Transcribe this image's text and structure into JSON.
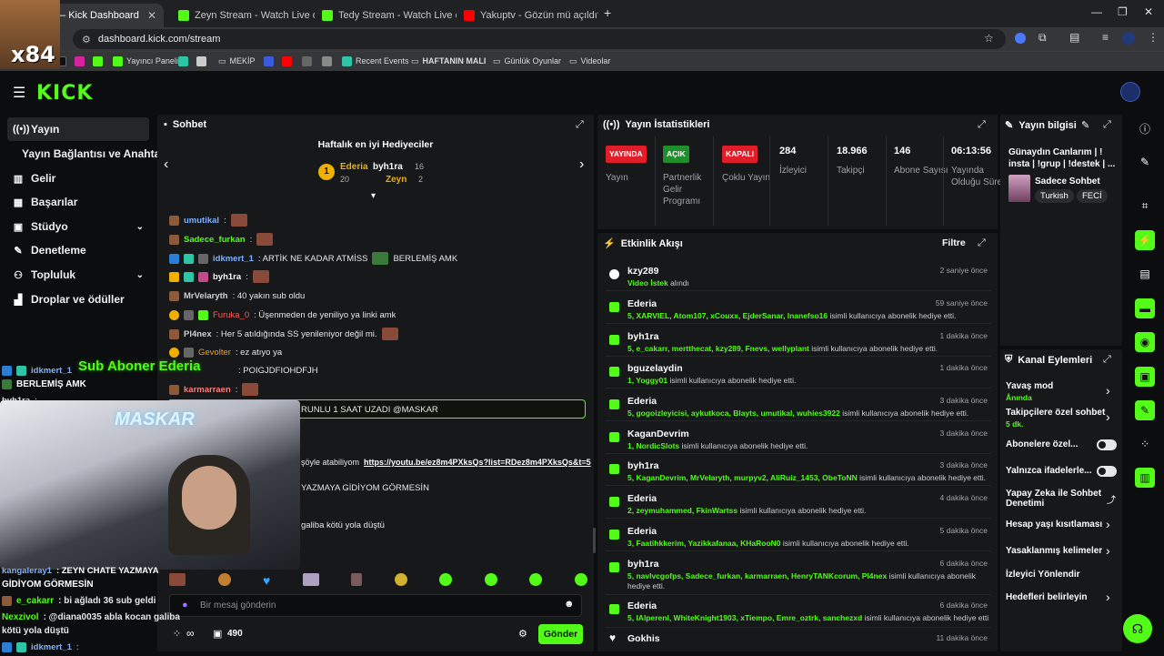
{
  "browser": {
    "tabs": [
      {
        "label": "Kick Dashboard",
        "prefix": "– ",
        "active": true,
        "favicon": "kick"
      },
      {
        "label": "Zeyn Stream - Watch Live on Ki",
        "active": false,
        "favicon": "kick"
      },
      {
        "label": "Tedy Stream - Watch Live on Ki",
        "active": false,
        "favicon": "kick"
      },
      {
        "label": "Yakuptv - Gözün mü açıldı? Gö",
        "active": false,
        "favicon": "youtube"
      }
    ],
    "url": "dashboard.kick.com/stream",
    "bookmarks": [
      "Yayıncı Paneli",
      "MEKİP",
      "Recent Events",
      "HAFTANIN MALI",
      "Günlük Oyunlar",
      "Videolar"
    ]
  },
  "overlay": {
    "streamer_tag": "x84",
    "cam_label": "MASKAR",
    "alert_text": "Sub Aboner Ederia",
    "side_chat": [
      {
        "user": "idkmert_1",
        "text": ""
      },
      {
        "user": "",
        "text": "BERLEMİŞ AMK"
      },
      {
        "user": "byh1ra",
        "text": ":"
      },
      {
        "user": "kangaleray1",
        "text": ": ZEYN CHATE YAZMAYA"
      },
      {
        "user": "",
        "text": "GİDİYOM GÖRMESİN"
      },
      {
        "user": "e_cakarr",
        "text": ": bi ağladı 36 sub geldi"
      },
      {
        "user": "Nexzivol",
        "text": ": @diana0035 abla kocan galiba"
      },
      {
        "user": "",
        "text": "kötü yola düştü"
      },
      {
        "user": "idkmert_1",
        "text": ":"
      }
    ]
  },
  "sidebar": {
    "items": [
      {
        "label": "Yayın",
        "icon": "broadcast-icon",
        "active": true
      },
      {
        "label": "Yayın Bağlantısı ve Anahtarı",
        "icon": "",
        "active": false
      },
      {
        "label": "Gelir",
        "icon": "revenue-icon"
      },
      {
        "label": "Başarılar",
        "icon": "achievements-icon"
      },
      {
        "label": "Stüdyo",
        "icon": "studio-icon",
        "chevron": true
      },
      {
        "label": "Denetleme",
        "icon": "moderation-icon"
      },
      {
        "label": "Topluluk",
        "icon": "community-icon",
        "chevron": true
      },
      {
        "label": "Droplar ve ödüller",
        "icon": "drops-icon"
      }
    ]
  },
  "chat": {
    "title": "Sohbet",
    "gifters_title": "Haftalık en iyi Hediyeciler",
    "gifters": [
      {
        "rank": "1",
        "name": "Ederia",
        "count": "20"
      },
      {
        "rank": "",
        "name": "byh1ra",
        "count": "16"
      },
      {
        "rank": "",
        "name": "Zeyn",
        "count": "2"
      }
    ],
    "messages": [
      {
        "user": "umutikal",
        "text": ":",
        "color": "#7fb0ff"
      },
      {
        "user": "Sadece_furkan",
        "text": ":",
        "color": "#53fc18"
      },
      {
        "user": "idkmert_1",
        "text": ": ARTİK NE KADAR ATMİSS",
        "text2": "BERLEMİŞ AMK",
        "color": "#7fb0ff"
      },
      {
        "user": "byh1ra",
        "text": ":",
        "color": "#ffffff"
      },
      {
        "user": "MrVelaryth",
        "text": ": 40 yakın sub oldu",
        "color": "#cfcfcf"
      },
      {
        "user": "Furuka_0",
        "text": ": Üşenmeden de yeniliyo ya linki amk",
        "color": "#ff5b5b"
      },
      {
        "user": "Pl4nex",
        "text": ": Her 5 atıldığında SS yenileniyor değil mi.",
        "color": "#cfcfcf"
      },
      {
        "user": "Gevolter",
        "text": ": ez atıyo ya",
        "color": "#f0a020"
      },
      {
        "user": "",
        "text": ": POIGJDFIOHDFJH",
        "color": "#ff5b5b"
      },
      {
        "user": "karmarraen",
        "text": ":",
        "color": "#ff7a7a"
      }
    ],
    "highlight": "RUNLU 1 SAAT UZADI @MASKAR",
    "link_prefix": "şöyle atabiliyom",
    "link": "https://youtu.be/ez8m4PXksQs?list=RDez8m4PXksQs&t=5",
    "msg_a": "YAZMAYA GİDİYOM GÖRMESİN",
    "msg_b": "galiba kötü yola düştü",
    "input_placeholder": "Bir mesaj gönderin",
    "points": "490",
    "send_label": "Gönder",
    "infinity": "∞"
  },
  "stats": {
    "title": "Yayın İstatistikleri",
    "items": [
      {
        "pill": "YAYINDA",
        "pill_color": "#e11d2a",
        "label": "Yayın"
      },
      {
        "pill": "AÇIK",
        "pill_color": "#1e8f2a",
        "label": "Partnerlik Gelir Programı"
      },
      {
        "pill": "KAPALI",
        "pill_color": "#e11d2a",
        "label": "Çoklu Yayın"
      },
      {
        "value": "284",
        "label": "İzleyici"
      },
      {
        "value": "18.966",
        "label": "Takipçi"
      },
      {
        "value": "146",
        "label": "Abone Sayısı"
      },
      {
        "value": "06:13:56",
        "label": "Yayında Olduğu Süre"
      }
    ]
  },
  "activity": {
    "title": "Etkinlik Akışı",
    "filter": "Filtre",
    "items": [
      {
        "name": "kzy289",
        "time": "2 saniye önce",
        "desc_bold": "Video İstek",
        "desc": " alındı"
      },
      {
        "name": "Ederia",
        "time": "59 saniye önce",
        "desc_bold": "5, XARVIEL, Atom107, xCouxx, EjderSanar, lnanefso16",
        "desc": " isimli kullanıcıya abonelik hediye etti."
      },
      {
        "name": "byh1ra",
        "time": "1 dakika önce",
        "desc_bold": "5, e_cakarr, mertthecat, kzy289, Fnevs, wellyplant",
        "desc": " isimli kullanıcıya abonelik hediye etti."
      },
      {
        "name": "bguzelaydin",
        "time": "1 dakika önce",
        "desc_bold": "1, Yoggy01",
        "desc": " isimli kullanıcıya abonelik hediye etti."
      },
      {
        "name": "Ederia",
        "time": "3 dakika önce",
        "desc_bold": "5, gogoizleyicisi, aykutkoca, Blayts, umutikal, wuhies3922",
        "desc": " isimli kullanıcıya abonelik hediye etti."
      },
      {
        "name": "KaganDevrim",
        "time": "3 dakika önce",
        "desc_bold": "1, NordicSlots",
        "desc": " isimli kullanıcıya abonelik hediye etti."
      },
      {
        "name": "byh1ra",
        "time": "3 dakika önce",
        "desc_bold": "5, KaganDevrim, MrVelaryth, murpyv2, AliRuiz_1453, ObeToNN",
        "desc": " isimli kullanıcıya abonelik hediye etti."
      },
      {
        "name": "Ederia",
        "time": "4 dakika önce",
        "desc_bold": "2, zeymuhammed, FkinWartss",
        "desc": " isimli kullanıcıya abonelik hediye etti."
      },
      {
        "name": "Ederia",
        "time": "5 dakika önce",
        "desc_bold": "3, Faatihkkerim, Yazikkafanaa, KHaRooN0",
        "desc": " isimli kullanıcıya abonelik hediye etti."
      },
      {
        "name": "byh1ra",
        "time": "6 dakika önce",
        "desc_bold": "5, navlvcgofps, Sadece_furkan, karmarraen, HenryTANKcorum, Pl4nex",
        "desc": " isimli kullanıcıya abonelik hediye etti."
      },
      {
        "name": "Ederia",
        "time": "6 dakika önce",
        "desc_bold": "5, IAlperenl, WhiteKnight1903, xTiempo, Emre_oztrk, sanchezxd",
        "desc": " isimli kullanıcıya abonelik hediye etti."
      },
      {
        "name": "Gokhis",
        "time": "11 dakika önce",
        "desc_bold": "",
        "desc": ""
      }
    ]
  },
  "stream_info": {
    "title": "Yayın bilgisi",
    "stream_title": "Günaydın Canlarım | ! insta | !grup | !destek | ...",
    "category": "Sadece Sohbet",
    "tags": [
      "Turkish",
      "FECİ"
    ]
  },
  "channel_actions": {
    "title": "Kanal Eylemleri",
    "items": [
      {
        "label": "Yavaş mod",
        "sub": "Ânında",
        "kind": "chevron"
      },
      {
        "label": "Takipçilere özel sohbet",
        "sub": "5 dk.",
        "kind": "chevron"
      },
      {
        "label": "Abonelere özel...",
        "sub": "",
        "kind": "toggle"
      },
      {
        "label": "Yalnızca ifadelerle...",
        "sub": "",
        "kind": "toggle"
      },
      {
        "label": "Yapay Zeka ile Sohbet Denetimi",
        "sub": "",
        "kind": "external"
      },
      {
        "label": "Hesap yaşı kısıtlaması",
        "sub": "",
        "kind": "chevron"
      },
      {
        "label": "Yasaklanmış kelimeler",
        "sub": "",
        "kind": "chevron"
      },
      {
        "label": "İzleyici Yönlendir",
        "sub": "",
        "kind": "none"
      },
      {
        "label": "Hedefleri belirleyin",
        "sub": "",
        "kind": "chevron"
      }
    ]
  },
  "colors": {
    "accent": "#53fc18",
    "live": "#e11d2a",
    "panel": "#16181a"
  }
}
